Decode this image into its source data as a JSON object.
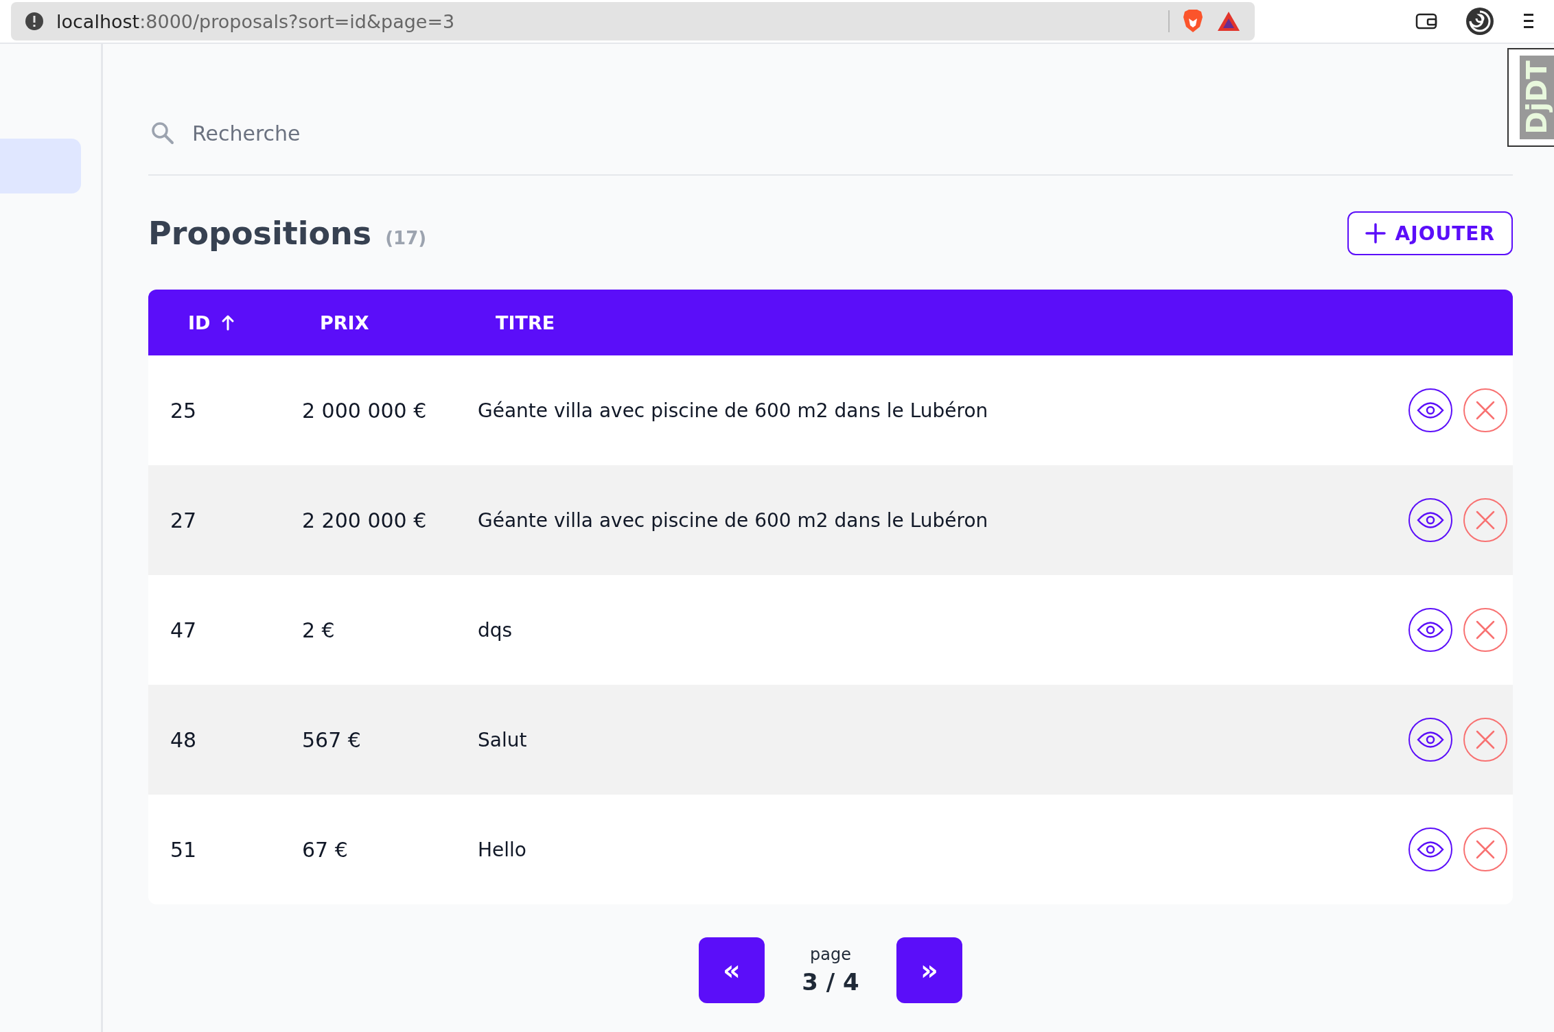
{
  "browser": {
    "url_host": "localhost",
    "url_rest": ":8000/proposals?sort=id&page=3"
  },
  "debug_toolbar": {
    "label": "DjDT"
  },
  "search": {
    "placeholder": "Recherche"
  },
  "heading": {
    "title": "Propositions",
    "count": "(17)"
  },
  "add_button": {
    "label": "AJOUTER"
  },
  "table": {
    "columns": [
      {
        "label": "ID",
        "sorted": true
      },
      {
        "label": "PRIX",
        "sorted": false
      },
      {
        "label": "TITRE",
        "sorted": false
      }
    ],
    "rows": [
      {
        "id": "25",
        "price": "2 000 000 €",
        "title": "Géante villa avec piscine de 600 m2 dans le Lubéron"
      },
      {
        "id": "27",
        "price": "2 200 000 €",
        "title": "Géante villa avec piscine de 600 m2 dans le Lubéron"
      },
      {
        "id": "47",
        "price": "2 €",
        "title": "dqs"
      },
      {
        "id": "48",
        "price": "567 €",
        "title": "Salut"
      },
      {
        "id": "51",
        "price": "67 €",
        "title": "Hello"
      }
    ]
  },
  "pagination": {
    "prev": "«",
    "label": "page",
    "current": "3 / 4",
    "next": "»"
  }
}
